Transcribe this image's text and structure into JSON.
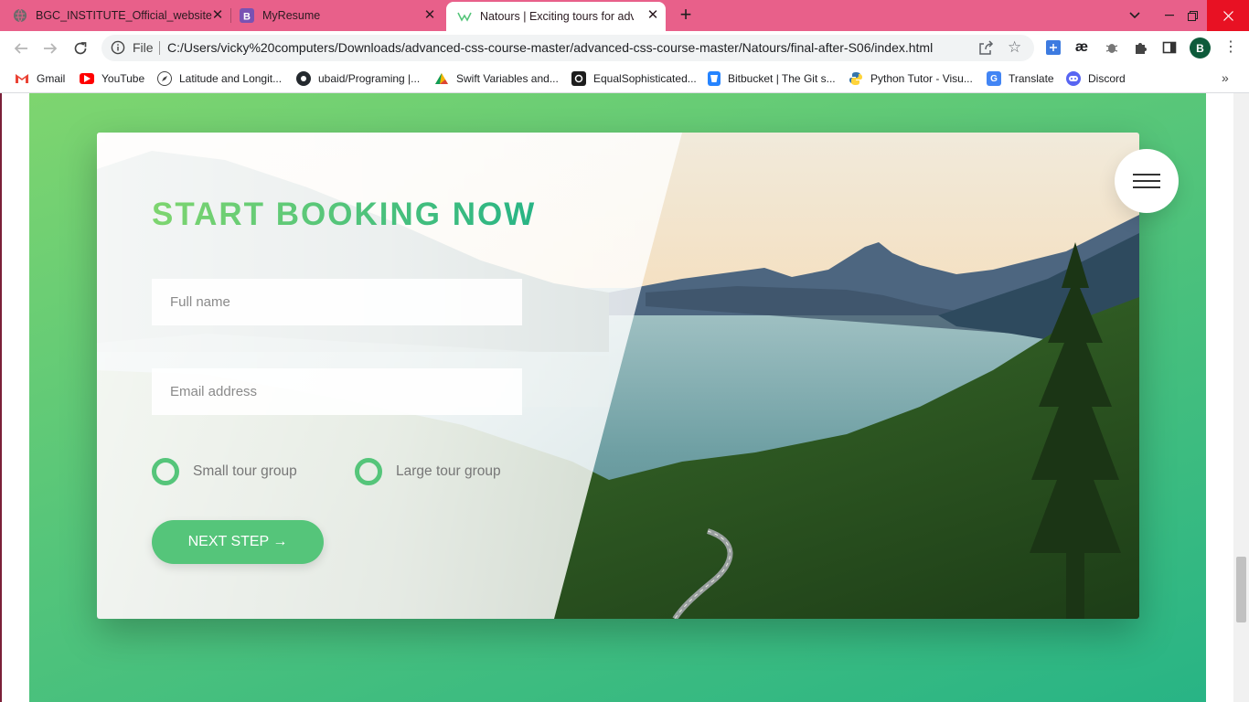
{
  "browser": {
    "tabs": [
      {
        "title": "BGC_INSTITUTE_Official_website",
        "icon": "globe-icon"
      },
      {
        "title": "MyResume",
        "icon": "bootstrap-icon"
      },
      {
        "title": "Natours | Exciting tours for adventurous people",
        "icon": "natours-icon",
        "active": true
      }
    ],
    "new_tab_label": "+",
    "address": {
      "scheme_label": "File",
      "url": "C:/Users/vicky%20computers/Downloads/advanced-css-course-master/advanced-css-course-master/Natours/final-after-S06/index.html"
    },
    "profile_initial": "B",
    "extensions": [
      "extension-icon",
      "ae-icon",
      "bug-icon",
      "puzzle-icon",
      "sidepanel-icon"
    ],
    "bookmarks": [
      {
        "label": "Gmail",
        "icon": "gmail-icon",
        "color": "#ea4335"
      },
      {
        "label": "YouTube",
        "icon": "youtube-icon",
        "color": "#ff0000"
      },
      {
        "label": "Latitude and Longit...",
        "icon": "compass-icon",
        "color": "#555555"
      },
      {
        "label": "ubaid/Programing |...",
        "icon": "github-icon",
        "color": "#24292e"
      },
      {
        "label": "Swift Variables and...",
        "icon": "swift-icon",
        "color": "#f05138"
      },
      {
        "label": "EqualSophisticated...",
        "icon": "replit-icon",
        "color": "#1d1d1d"
      },
      {
        "label": "Bitbucket | The Git s...",
        "icon": "bitbucket-icon",
        "color": "#2684ff"
      },
      {
        "label": "Python Tutor - Visu...",
        "icon": "python-icon",
        "color": "#3776ab"
      },
      {
        "label": "Translate",
        "icon": "translate-icon",
        "color": "#4285f4"
      },
      {
        "label": "Discord",
        "icon": "discord-icon",
        "color": "#5865f2"
      }
    ]
  },
  "page": {
    "booking": {
      "heading": "START BOOKING NOW",
      "name_placeholder": "Full name",
      "email_placeholder": "Email address",
      "options": [
        "Small tour group",
        "Large tour group"
      ],
      "button_label": "NEXT STEP →"
    },
    "colors": {
      "primary": "#55c57a",
      "primary_light": "#7ed56f",
      "primary_dark": "#28b485",
      "tab_strip": "#e8608a"
    }
  }
}
